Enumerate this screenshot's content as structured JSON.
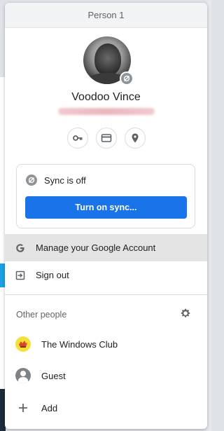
{
  "header": {
    "title": "Person 1"
  },
  "profile": {
    "name": "Voodoo Vince"
  },
  "quick_actions": [
    {
      "icon": "key-icon"
    },
    {
      "icon": "credit-card-icon"
    },
    {
      "icon": "location-pin-icon"
    }
  ],
  "sync": {
    "status": "Sync is off",
    "button_label": "Turn on sync..."
  },
  "menu": {
    "manage_account": "Manage your Google Account",
    "sign_out": "Sign out"
  },
  "other_people": {
    "title": "Other people",
    "people": [
      {
        "name": "The Windows Club",
        "icon": "twc-avatar-icon"
      },
      {
        "name": "Guest",
        "icon": "guest-avatar-icon"
      }
    ],
    "add_label": "Add"
  },
  "colors": {
    "accent": "#1a73e8",
    "header_bg": "#f1f3f4",
    "hover_bg": "#e4e4e4"
  }
}
